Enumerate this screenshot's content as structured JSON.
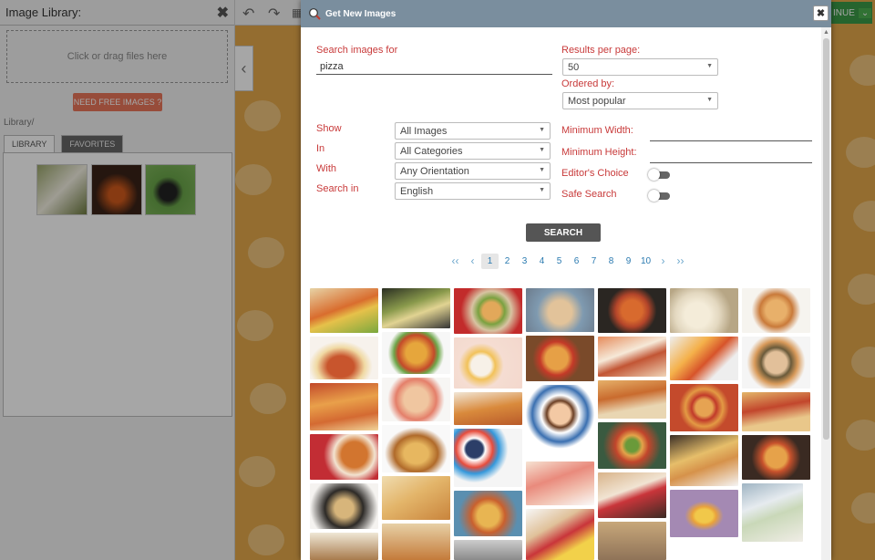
{
  "library": {
    "title": "Image Library:",
    "dropzone_text": "Click or drag files here",
    "free_images_label": "NEED FREE IMAGES ?",
    "path": "Library/",
    "tabs": [
      "LIBRARY",
      "FAVORITES"
    ]
  },
  "toolbar": {
    "continue_label": "INUE"
  },
  "modal": {
    "title": "Get New Images",
    "search_label": "Search images for",
    "search_value": "pizza",
    "results_per_page_label": "Results per page:",
    "results_per_page_value": "50",
    "ordered_by_label": "Ordered by:",
    "ordered_by_value": "Most popular",
    "show_label": "Show",
    "show_value": "All Images",
    "in_label": "In",
    "in_value": "All Categories",
    "with_label": "With",
    "with_value": "Any Orientation",
    "search_in_label": "Search in",
    "search_in_value": "English",
    "min_width_label": "Minimum Width:",
    "min_height_label": "Minimum Height:",
    "editors_choice_label": "Editor's Choice",
    "safe_search_label": "Safe Search",
    "search_button": "SEARCH",
    "pages": [
      "1",
      "2",
      "3",
      "4",
      "5",
      "6",
      "7",
      "8",
      "9",
      "10"
    ],
    "current_page": "1"
  },
  "colors": {
    "accent": "#c83a3a",
    "header": "#7a8e9e",
    "link": "#2a7ab0"
  }
}
